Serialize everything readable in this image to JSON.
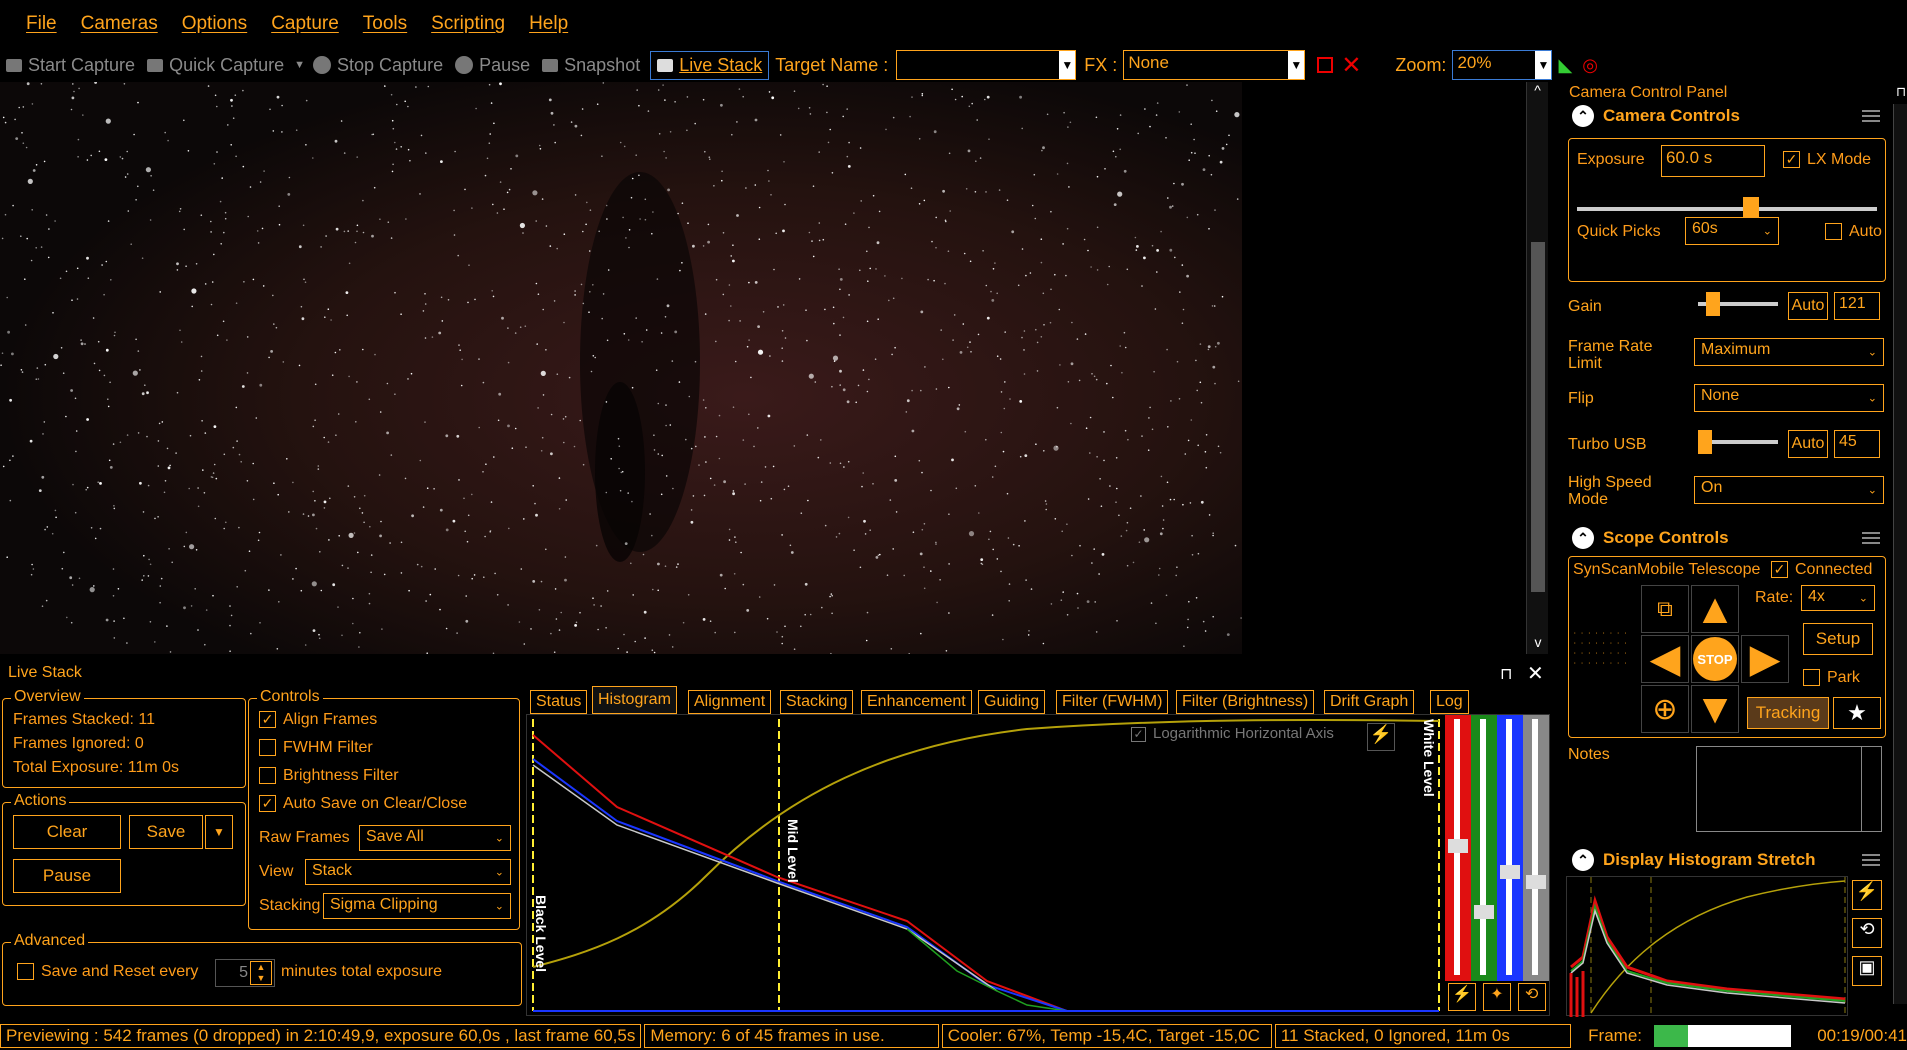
{
  "menu": [
    "File",
    "Cameras",
    "Options",
    "Capture",
    "Tools",
    "Scripting",
    "Help"
  ],
  "toolbar": {
    "start_capture": "Start Capture",
    "quick_capture": "Quick Capture",
    "stop_capture": "Stop Capture",
    "pause": "Pause",
    "snapshot": "Snapshot",
    "live_stack": "Live Stack",
    "target_name_label": "Target Name :",
    "target_name_value": "",
    "fx_label": "FX :",
    "fx_value": "None",
    "zoom_label": "Zoom:",
    "zoom_value": "20%"
  },
  "live_stack": {
    "title": "Live Stack",
    "overview": {
      "title": "Overview",
      "frames_stacked": "Frames Stacked:  11",
      "frames_ignored": "Frames Ignored:  0",
      "total_exposure": "Total Exposure:   11m 0s"
    },
    "actions": {
      "title": "Actions",
      "clear": "Clear",
      "save": "Save",
      "pause": "Pause"
    },
    "controls": {
      "title": "Controls",
      "align_frames": "Align Frames",
      "fwhm_filter": "FWHM Filter",
      "brightness_filter": "Brightness Filter",
      "auto_save": "Auto Save on Clear/Close",
      "raw_frames_label": "Raw Frames",
      "raw_frames_value": "Save All",
      "view_label": "View",
      "view_value": "Stack",
      "stacking_label": "Stacking",
      "stacking_value": "Sigma Clipping"
    },
    "advanced": {
      "title": "Advanced",
      "save_reset": "Save and Reset every",
      "minutes_value": "5",
      "minutes_label": "minutes total exposure"
    },
    "tabs": [
      "Status",
      "Histogram",
      "Alignment",
      "Stacking",
      "Enhancement",
      "Guiding",
      "Filter (FWHM)",
      "Filter (Brightness)",
      "Drift Graph",
      "Log"
    ],
    "histogram": {
      "log_axis": "Logarithmic Horizontal Axis",
      "black_level": "Black Level",
      "mid_level": "Mid Level",
      "white_level": "White Level"
    }
  },
  "camera_panel": {
    "title": "Camera Control Panel",
    "camera_controls": "Camera Controls",
    "exposure_label": "Exposure",
    "exposure_value": "60.0 s",
    "lx_mode": "LX Mode",
    "quick_picks_label": "Quick Picks",
    "quick_picks_value": "60s",
    "auto_label": "Auto",
    "gain_label": "Gain",
    "gain_auto": "Auto",
    "gain_value": "121",
    "frame_rate_label": "Frame Rate Limit",
    "frame_rate_value": "Maximum",
    "flip_label": "Flip",
    "flip_value": "None",
    "turbo_label": "Turbo USB",
    "turbo_auto": "Auto",
    "turbo_value": "45",
    "high_speed_label": "High Speed Mode",
    "high_speed_value": "On"
  },
  "scope_panel": {
    "title": "Scope Controls",
    "telescope": "SynScanMobile Telescope",
    "connected": "Connected",
    "rate_label": "Rate:",
    "rate_value": "4x",
    "setup": "Setup",
    "park": "Park",
    "stop": "STOP",
    "tracking": "Tracking"
  },
  "notes_label": "Notes",
  "display_histogram": "Display Histogram Stretch",
  "status": {
    "previewing": "Previewing : 542 frames (0 dropped) in 2:10:49,9, exposure 60,0s , last frame 60,5s",
    "memory": "Memory: 6 of 45 frames in use.",
    "cooler": "Cooler: 67%, Temp -15,4C, Target -15,0C",
    "stacked": "11 Stacked, 0 Ignored, 11m 0s",
    "frame_label": "Frame:",
    "frame_progress": 0.25,
    "time": "00:19/00:41"
  },
  "colors": {
    "accent": "#ffa41c",
    "background": "#000000"
  }
}
